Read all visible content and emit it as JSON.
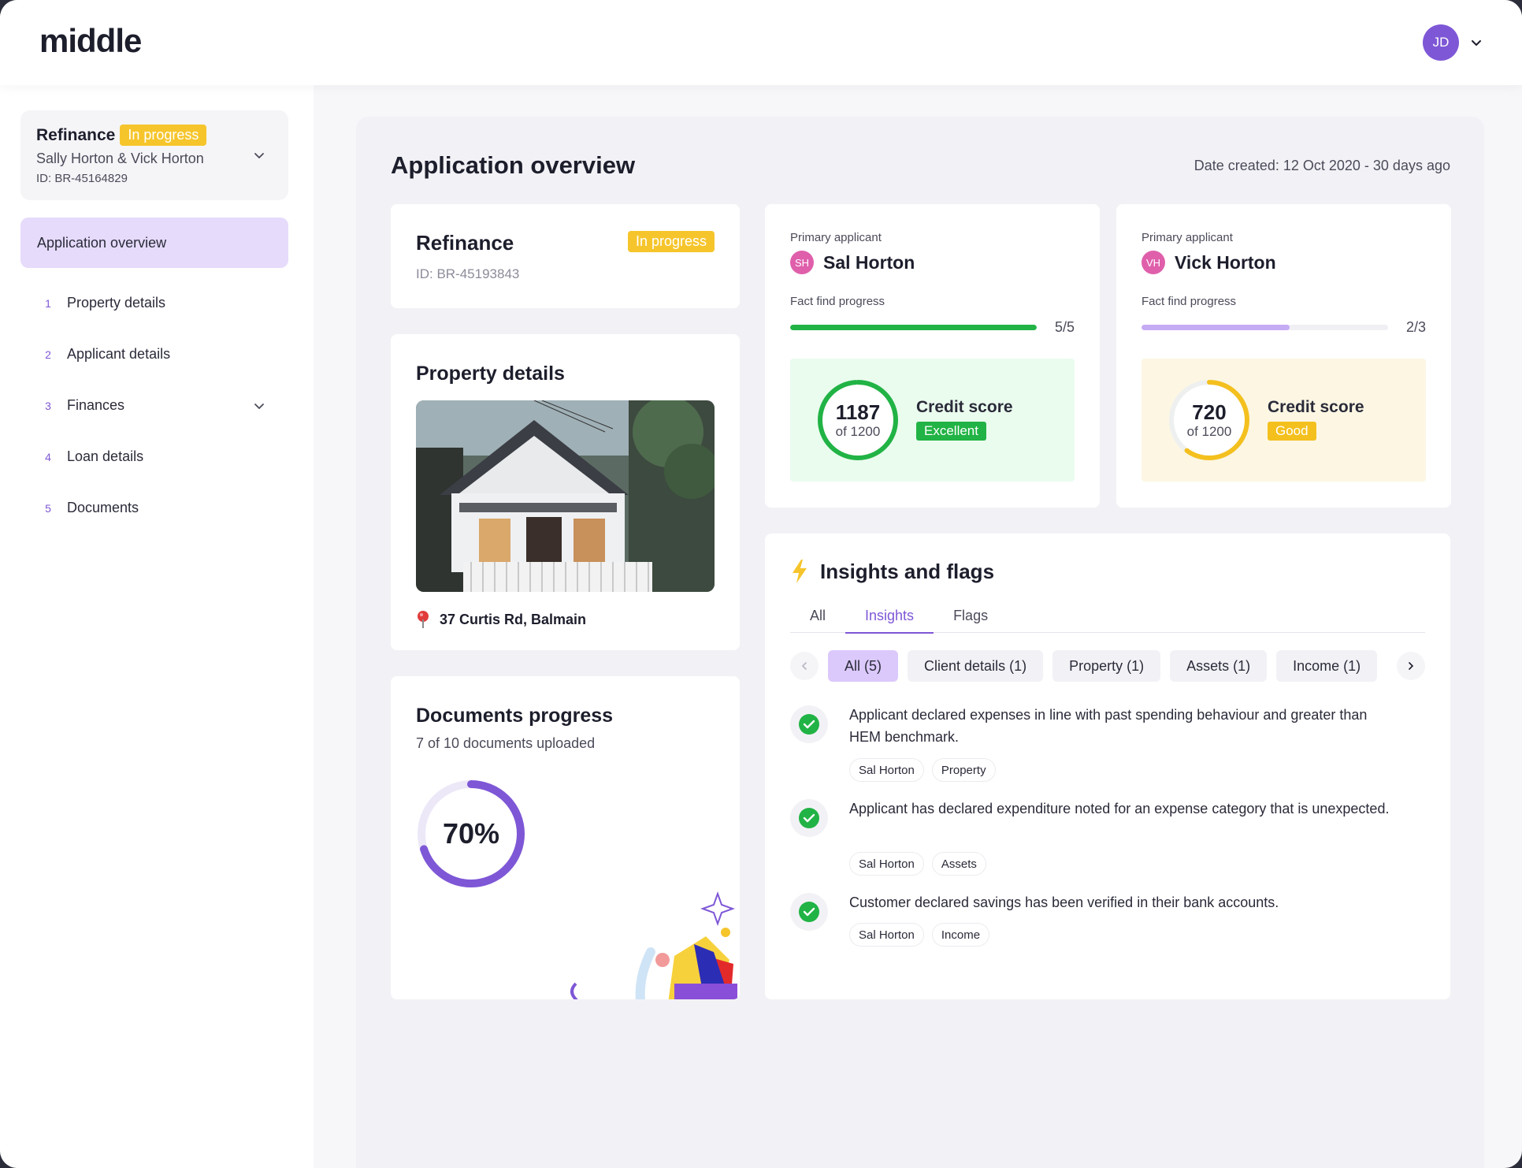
{
  "brand": {
    "logo": "middle"
  },
  "user": {
    "initials": "JD"
  },
  "sidebar": {
    "application": {
      "title": "Refinance",
      "status": "In progress",
      "names": "Sally Horton & Vick Horton",
      "id": "ID: BR-45164829"
    },
    "active_item": "Application overview",
    "items": [
      {
        "num": "1",
        "label": "Property details"
      },
      {
        "num": "2",
        "label": "Applicant details"
      },
      {
        "num": "3",
        "label": "Finances"
      },
      {
        "num": "4",
        "label": "Loan details"
      },
      {
        "num": "5",
        "label": "Documents"
      }
    ]
  },
  "main": {
    "title": "Application overview",
    "date_created": "Date created: 12 Oct 2020 - 30 days ago",
    "refinance": {
      "title": "Refinance",
      "status": "In progress",
      "id": "ID: BR-45193843"
    },
    "property": {
      "title": "Property details",
      "address": "37 Curtis Rd, Balmain",
      "icon": "map-pin-icon"
    },
    "documents": {
      "title": "Documents progress",
      "subtitle": "7 of 10 documents uploaded",
      "percent_label": "70%",
      "progress": 0.7
    },
    "applicants": [
      {
        "label": "Primary applicant",
        "initials": "SH",
        "name": "Sal Horton",
        "fact_find_label": "Fact find progress",
        "fact_find_value": "5/5",
        "fact_find_progress": 1.0,
        "score": "1187",
        "score_of": "of 1200",
        "score_progress": 0.989,
        "score_label": "Credit score",
        "rating": "Excellent",
        "colors": {
          "accent": "#21b345",
          "box": "#eafcee",
          "bar": "#21b345"
        }
      },
      {
        "label": "Primary applicant",
        "initials": "VH",
        "name": "Vick Horton",
        "fact_find_label": "Fact find progress",
        "fact_find_value": "2/3",
        "fact_find_progress": 0.6,
        "score": "720",
        "score_of": "of 1200",
        "score_progress": 0.6,
        "score_label": "Credit score",
        "rating": "Good",
        "colors": {
          "accent": "#f4c01e",
          "box": "#fcf6e3",
          "bar": "#c5aaf4"
        }
      }
    ],
    "insights": {
      "title": "Insights and flags",
      "tabs": [
        "All",
        "Insights",
        "Flags"
      ],
      "active_tab": "Insights",
      "chips": [
        "All (5)",
        "Client details (1)",
        "Property (1)",
        "Assets (1)",
        "Income (1)"
      ],
      "items": [
        {
          "text": "Applicant declared expenses in line with past spending behaviour and greater than HEM benchmark.",
          "tags": [
            "Sal Horton",
            "Property"
          ]
        },
        {
          "text": "Applicant has declared expenditure noted for an expense category that is unexpected.",
          "tags": [
            "Sal Horton",
            "Assets"
          ]
        },
        {
          "text": "Customer declared savings has been verified in their bank accounts.",
          "tags": [
            "Sal Horton",
            "Income"
          ]
        }
      ]
    }
  }
}
